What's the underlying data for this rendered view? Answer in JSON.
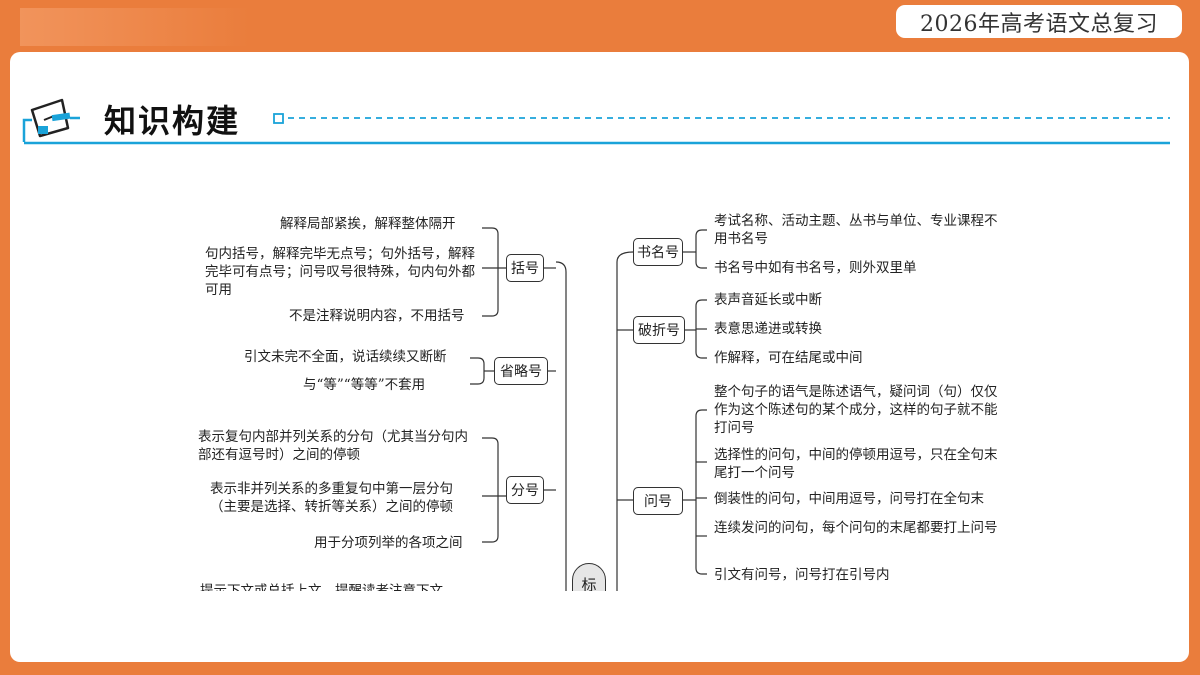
{
  "badge": "2026年高考语文总复习",
  "section_title": "知识构建",
  "center_node": "标",
  "left": {
    "kuohao": {
      "label": "括号",
      "items": [
        "解释局部紧挨，解释整体隔开",
        "句内括号，解释完毕无点号；句外括号，解释完毕可有点号；问号叹号很特殊，句内句外都可用",
        "不是注释说明内容，不用括号"
      ]
    },
    "shenglue": {
      "label": "省略号",
      "items": [
        "引文未完不全面，说话续续又断断",
        "与“等”“等等”不套用"
      ]
    },
    "fenhao": {
      "label": "分号",
      "items": [
        "表示复句内部并列关系的分句（尤其当分句内部还有逗号时）之间的停顿",
        "表示非并列关系的多重复句中第一层分句（主要是选择、转折等关系）之间的停顿",
        "用于分项列举的各项之间"
      ]
    },
    "cut_line": "提示下文或总括上文，提醒读者注意下文"
  },
  "right": {
    "shuming": {
      "label": "书名号",
      "items": [
        "考试名称、活动主题、丛书与单位、专业课程不用书名号",
        "书名号中如有书名号，则外双里单"
      ]
    },
    "pozhe": {
      "label": "破折号",
      "items": [
        "表声音延长或中断",
        "表意思递进或转换",
        "作解释，可在结尾或中间"
      ]
    },
    "wenhao": {
      "label": "问号",
      "items": [
        "整个句子的语气是陈述语气，疑问词（句）仅仅作为这个陈述句的某个成分，这样的句子就不能打问号",
        "选择性的问句，中间的停顿用逗号，只在全句末尾打一个问号",
        "倒装性的问句，中间用逗号，问号打在全句末",
        "连续发问的问句，每个问句的末尾都要打上问号",
        "引文有问号，问号打在引号内"
      ]
    }
  },
  "colors": {
    "accent": "#ea7d3c",
    "blue": "#1aa3d9"
  }
}
